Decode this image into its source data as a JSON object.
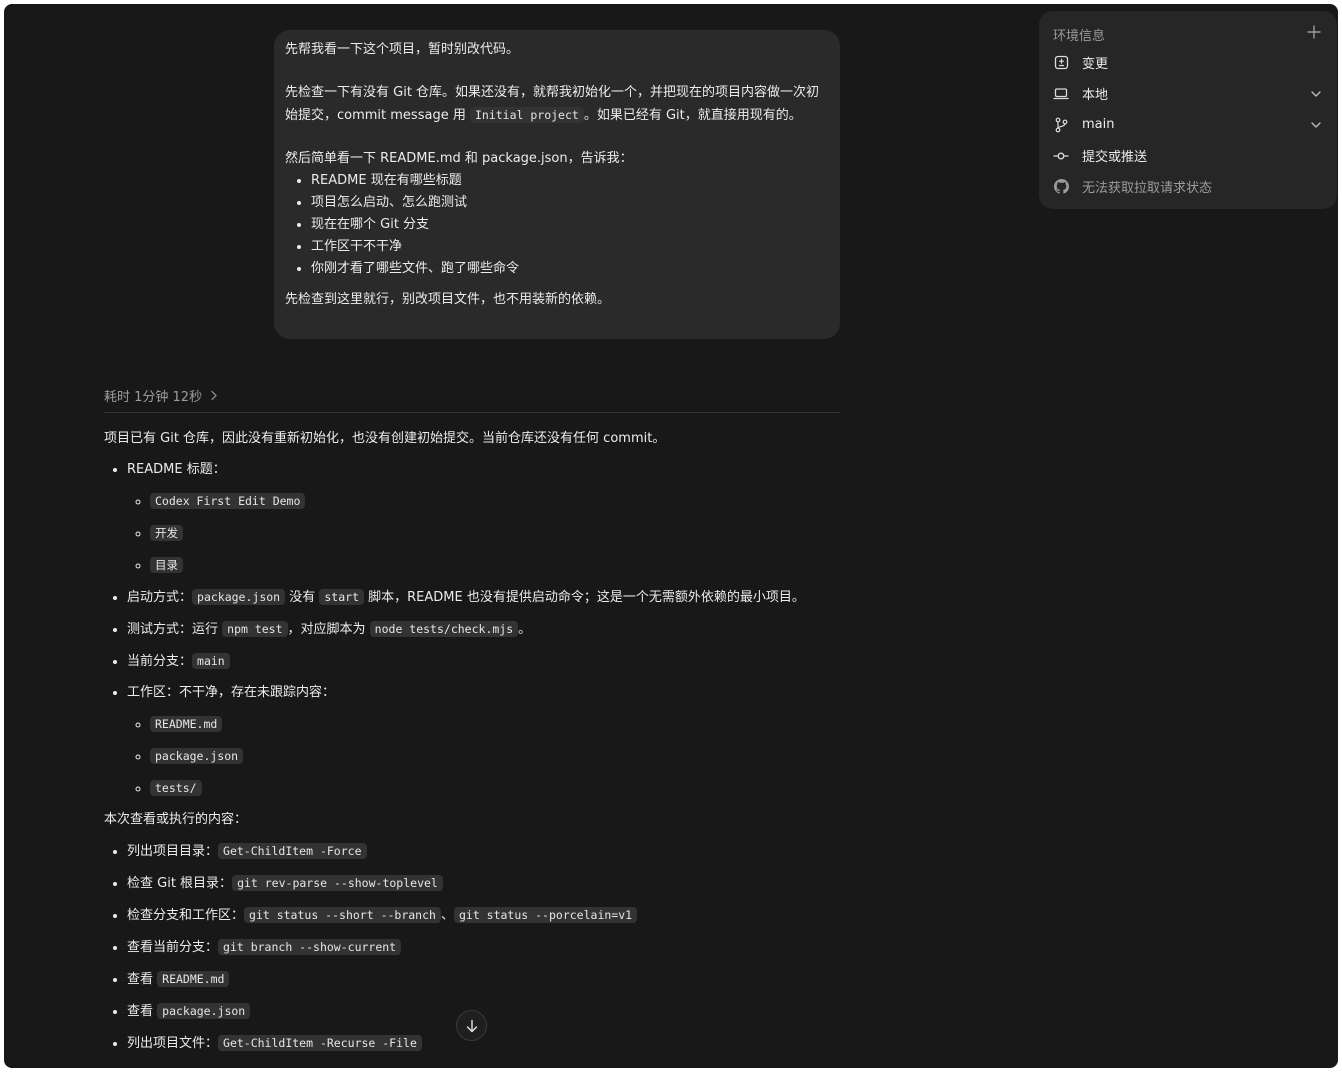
{
  "user_message": {
    "line1": "先帮我看一下这个项目，暂时别改代码。",
    "p2_a": "先检查一下有没有 Git 仓库。如果还没有，就帮我初始化一个，并把现在的项目内容做一次初始提交，commit message 用 ",
    "p2_code": "Initial project",
    "p2_b": "。如果已经有 Git，就直接用现有的。",
    "p3": "然后简单看一下 README.md 和 package.json，告诉我：",
    "items": [
      "README 现在有哪些标题",
      "项目怎么启动、怎么跑测试",
      "现在在哪个 Git 分支",
      "工作区干不干净",
      "你刚才看了哪些文件、跑了哪些命令"
    ],
    "closing": "先检查到这里就行，别改项目文件，也不用装新的依赖。"
  },
  "env_panel": {
    "title": "环境信息",
    "add_icon": "plus-icon",
    "rows": [
      {
        "label": "变更",
        "icon": "diff-icon"
      },
      {
        "label": "本地",
        "icon": "laptop-icon"
      },
      {
        "label": "main",
        "icon": "git-branch-icon"
      },
      {
        "label": "提交或推送",
        "icon": "git-commit-icon"
      },
      {
        "label": "无法获取拉取请求状态",
        "icon": "github-icon"
      }
    ]
  },
  "answer": {
    "elapsed": "耗时 1分钟 12秒",
    "intro": "项目已有 Git 仓库，因此没有重新初始化，也没有创建初始提交。当前仓库还没有任何 commit。",
    "readme_label": "README 标题：",
    "readme_titles": [
      "Codex First Edit Demo",
      "开发",
      "目录"
    ],
    "start_a": "启动方式：",
    "start_code1": "package.json",
    "start_b": " 没有 ",
    "start_code2": "start",
    "start_c": " 脚本，README 也没有提供启动命令；这是一个无需额外依赖的最小项目。",
    "test_a": "测试方式：运行 ",
    "test_code1": "npm test",
    "test_b": "，对应脚本为 ",
    "test_code2": "node tests/check.mjs",
    "test_c": "。",
    "branch_label": "当前分支：",
    "branch_value": "main",
    "worktree_label": "工作区：不干净，存在未跟踪内容：",
    "untracked": [
      "README.md",
      "package.json",
      "tests/"
    ],
    "section_title": "本次查看或执行的内容：",
    "actions": [
      {
        "label": "列出项目目录：",
        "codes": [
          "Get-ChildItem -Force"
        ]
      },
      {
        "label": "检查 Git 根目录：",
        "codes": [
          "git rev-parse --show-toplevel"
        ]
      },
      {
        "label": "检查分支和工作区：",
        "codes": [
          "git status --short --branch",
          "git status --porcelain=v1"
        ]
      },
      {
        "label": "查看当前分支：",
        "codes": [
          "git branch --show-current"
        ]
      },
      {
        "label": "查看 ",
        "codes": [
          "README.md"
        ]
      },
      {
        "label": "查看 ",
        "codes": [
          "package.json"
        ]
      },
      {
        "label": "列出项目文件：",
        "codes": [
          "Get-ChildItem -Recurse -File"
        ]
      }
    ],
    "separator": "、"
  },
  "scroll_button_icon": "arrow-down-icon",
  "colors": {
    "background": "#181818",
    "bubble": "#2a2a2a",
    "panel": "#262626",
    "code_bg": "#333333",
    "muted": "#9c9c9c"
  }
}
